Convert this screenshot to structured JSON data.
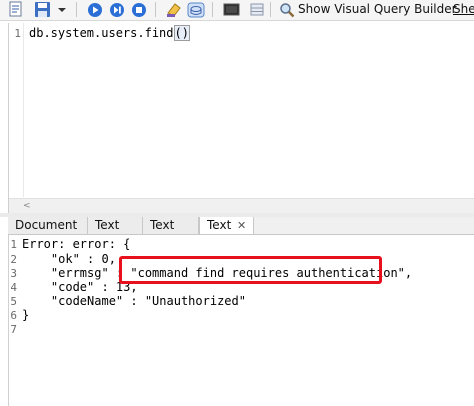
{
  "colors": {
    "highlight_border": "#e8101c",
    "toolbar_bg": "#f5f5f5",
    "tab_active_bg": "#ffffff"
  },
  "toolbar": {
    "icons": [
      "save-icon",
      "dropdown-arrow-icon",
      "run-icon",
      "run-selection-icon",
      "stop-icon",
      "clear-icon",
      "explain-icon",
      "console-icon",
      "visual-query-builder-icon"
    ],
    "visual_query_builder_label": "Show Visual Query Builder",
    "she_label": "She"
  },
  "editor": {
    "line_number": "1",
    "code_prefix": "db.system.users.find",
    "code_parens": "()"
  },
  "result_tabs": [
    {
      "label": "Document"
    },
    {
      "label": "Text"
    },
    {
      "label": "Text"
    },
    {
      "label": "Text",
      "close": "✕"
    }
  ],
  "result": {
    "lines": [
      {
        "num": "1",
        "text": "Error: error: {"
      },
      {
        "num": "2",
        "text": "    \"ok\" : 0,"
      },
      {
        "num": "3",
        "text": "    \"errmsg\" : \"command find requires authentication\","
      },
      {
        "num": "4",
        "text": "    \"code\" : 13,"
      },
      {
        "num": "5",
        "text": "    \"codeName\" : \"Unauthorized\""
      },
      {
        "num": "6",
        "text": "}"
      },
      {
        "num": "7",
        "text": ""
      }
    ]
  }
}
